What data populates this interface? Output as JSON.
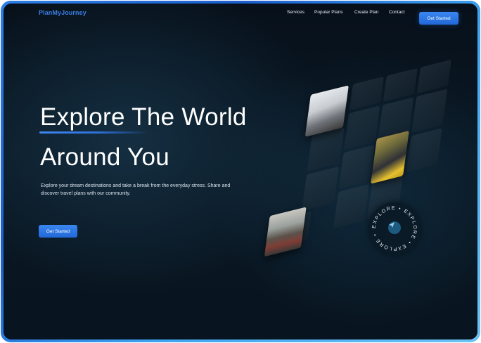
{
  "brand": {
    "logo_text": "PlanMyJourney"
  },
  "nav": {
    "links": [
      "Services",
      "Popular Plans",
      "Create Plan",
      "Contact"
    ],
    "cta_label": "Get Started"
  },
  "hero": {
    "title_line1": "Explore The World",
    "title_line2": "Around You",
    "description": "Explore your dream destinations and take a break from the everyday stress. Share and discover travel plans with our community.",
    "cta_label": "Get Started"
  },
  "badge": {
    "seal_text": "EXPLORE • EXPLORE • EXPLORE • ",
    "icon": "paper-plane-icon"
  },
  "colors": {
    "accent": "#2f78e6",
    "logo": "#3b7fe4",
    "frame_gradient_start": "#2f7fe8",
    "frame_gradient_end": "#6cc3f4",
    "background": "#08141f"
  }
}
